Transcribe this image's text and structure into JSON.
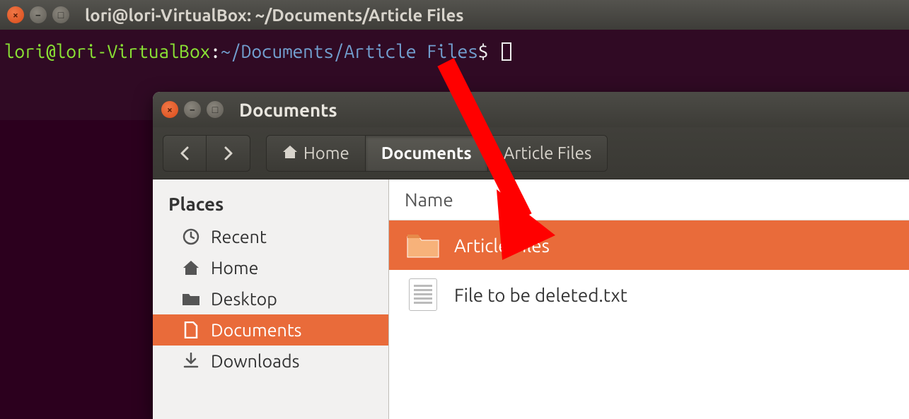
{
  "terminal": {
    "title": "lori@lori-VirtualBox: ~/Documents/Article Files",
    "prompt_userhost": "lori@lori-VirtualBox",
    "prompt_colon": ":",
    "prompt_path": "~/Documents/Article Files",
    "prompt_suffix": "$ "
  },
  "nautilus": {
    "title": "Documents",
    "breadcrumb": {
      "home": "Home",
      "documents": "Documents",
      "article": "Article Files"
    },
    "sidebar": {
      "header": "Places",
      "items": [
        {
          "label": "Recent",
          "icon": "clock-icon"
        },
        {
          "label": "Home",
          "icon": "home-icon"
        },
        {
          "label": "Desktop",
          "icon": "folder-icon"
        },
        {
          "label": "Documents",
          "icon": "document-icon"
        },
        {
          "label": "Downloads",
          "icon": "download-icon"
        }
      ]
    },
    "list": {
      "column": "Name",
      "rows": [
        {
          "name": "Article Files",
          "type": "folder",
          "selected": true
        },
        {
          "name": "File to be deleted.txt",
          "type": "file",
          "selected": false
        }
      ]
    }
  },
  "colors": {
    "accent": "#e96b3a",
    "desktop_bg": "#2c001e",
    "terminal_bg": "#300a24"
  }
}
